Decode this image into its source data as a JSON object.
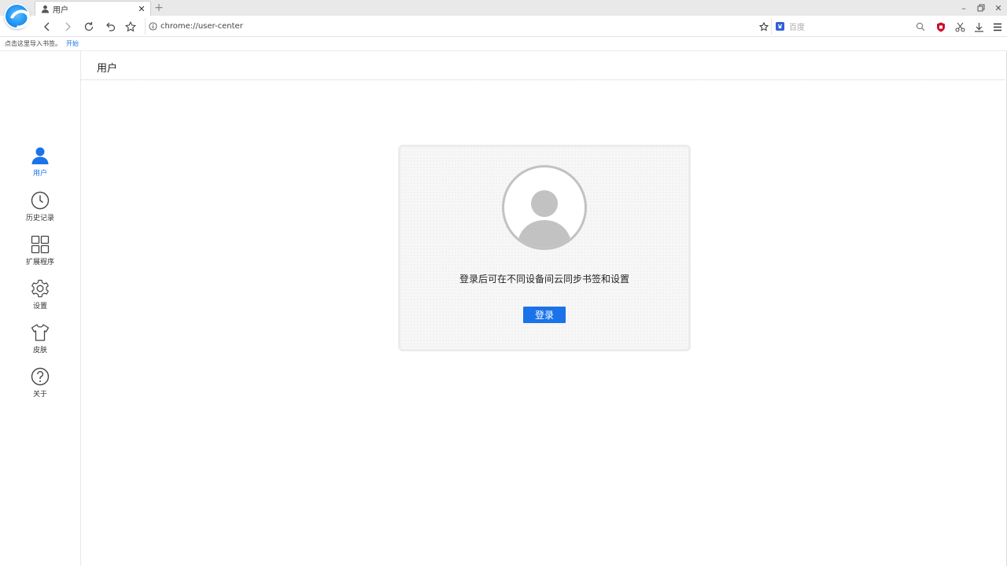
{
  "tab": {
    "title": "用户"
  },
  "address_bar": {
    "url": "chrome://user-center"
  },
  "search": {
    "placeholder": "百度"
  },
  "bookmarks_bar": {
    "prompt": "点击这里导入书签。",
    "start_link": "开始"
  },
  "sidebar": {
    "items": [
      {
        "label": "用户",
        "icon": "user-icon",
        "active": true
      },
      {
        "label": "历史记录",
        "icon": "clock-icon",
        "active": false
      },
      {
        "label": "扩展程序",
        "icon": "grid-icon",
        "active": false
      },
      {
        "label": "设置",
        "icon": "gear-icon",
        "active": false
      },
      {
        "label": "皮肤",
        "icon": "shirt-icon",
        "active": false
      },
      {
        "label": "关于",
        "icon": "question-icon",
        "active": false
      }
    ]
  },
  "main": {
    "title": "用户",
    "login_message": "登录后可在不同设备间云同步书签和设置",
    "login_button": "登录"
  },
  "colors": {
    "accent": "#1a73e8",
    "avatar_gray": "#c2c2c2"
  }
}
